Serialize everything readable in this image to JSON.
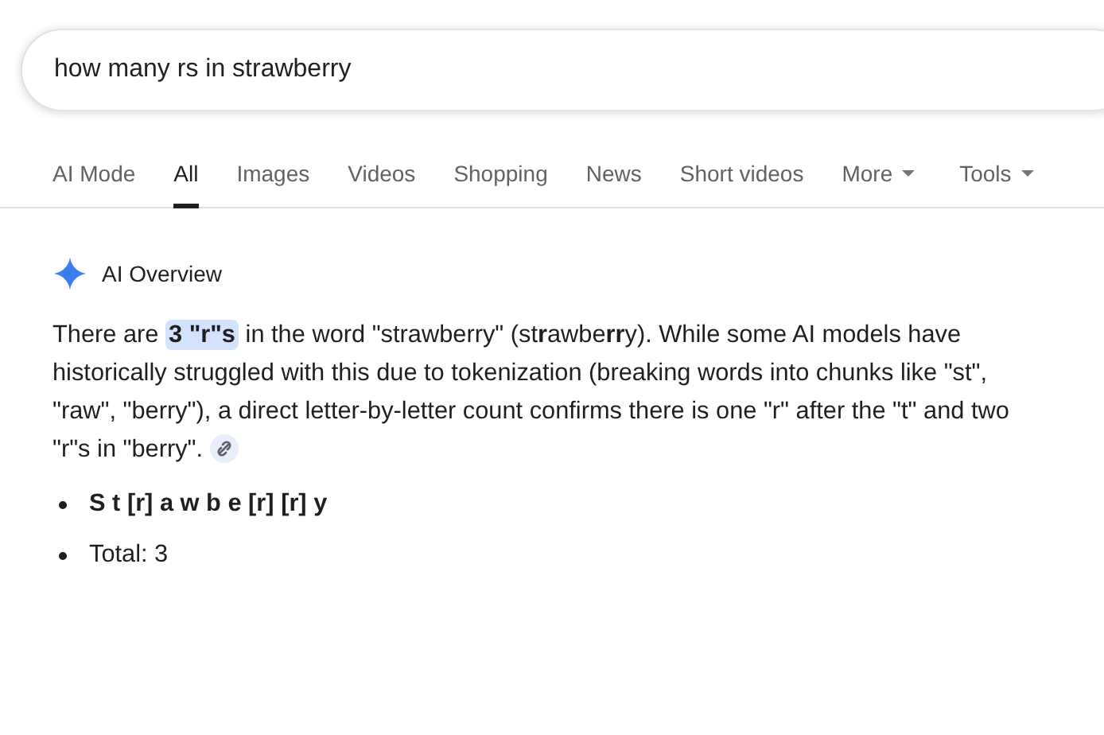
{
  "search": {
    "value": "how many rs in strawberry"
  },
  "tabs": [
    {
      "label": "AI Mode",
      "selected": false,
      "dropdown": false
    },
    {
      "label": "All",
      "selected": true,
      "dropdown": false
    },
    {
      "label": "Images",
      "selected": false,
      "dropdown": false
    },
    {
      "label": "Videos",
      "selected": false,
      "dropdown": false
    },
    {
      "label": "Shopping",
      "selected": false,
      "dropdown": false
    },
    {
      "label": "News",
      "selected": false,
      "dropdown": false
    },
    {
      "label": "Short videos",
      "selected": false,
      "dropdown": false
    },
    {
      "label": "More",
      "selected": false,
      "dropdown": true
    },
    {
      "label": "Tools",
      "selected": false,
      "dropdown": true
    }
  ],
  "overview": {
    "title": "AI Overview",
    "paragraph": [
      {
        "kind": "text",
        "text": "There are "
      },
      {
        "kind": "highlight",
        "text": "3 \"r\"s"
      },
      {
        "kind": "text",
        "text": " in the word \"strawberry\" (st**r**awbe**rr**y). While some AI models have historically struggled with this due to tokenization (breaking words into chunks like \"st\", \"raw\", \"berry\"), a direct letter-by-letter count confirms there is one \"r\" after the \"t\" and two \"r\"s in \"berry\"."
      }
    ],
    "bullets": [
      {
        "text": "S t [r] a w b e [r] [r] y",
        "bold": true
      },
      {
        "text": "Total: 3",
        "bold": false
      }
    ]
  }
}
